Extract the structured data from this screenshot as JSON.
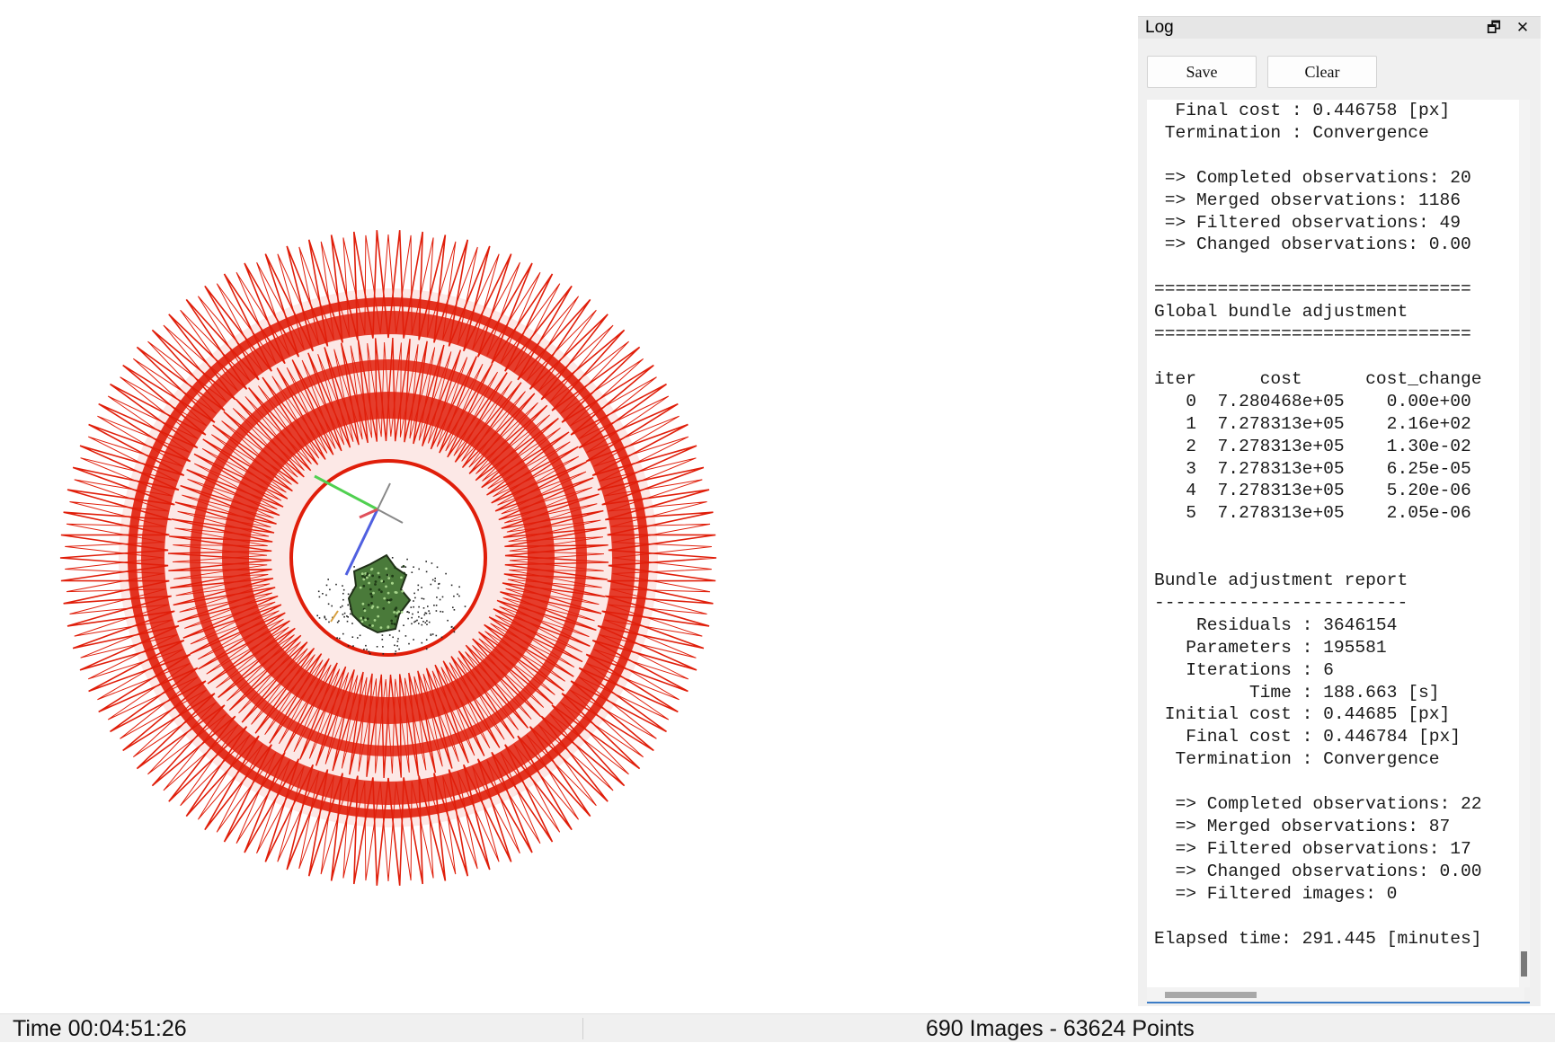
{
  "log_panel": {
    "title": "Log",
    "float_icon": "restore-window-icon",
    "close_icon": "close-icon",
    "save_label": "Save",
    "clear_label": "Clear",
    "lines": [
      "  Final cost : 0.446758 [px]",
      " Termination : Convergence",
      "",
      " => Completed observations: 20",
      " => Merged observations: 1186",
      " => Filtered observations: 49",
      " => Changed observations: 0.00",
      "",
      "==============================",
      "Global bundle adjustment",
      "==============================",
      "",
      "iter      cost      cost_change",
      "   0  7.280468e+05    0.00e+00",
      "   1  7.278313e+05    2.16e+02",
      "   2  7.278313e+05    1.30e-02",
      "   3  7.278313e+05    6.25e-05",
      "   4  7.278313e+05    5.20e-06",
      "   5  7.278313e+05    2.05e-06",
      "",
      "",
      "Bundle adjustment report",
      "------------------------",
      "    Residuals : 3646154",
      "   Parameters : 195581",
      "   Iterations : 6",
      "         Time : 188.663 [s]",
      " Initial cost : 0.44685 [px]",
      "   Final cost : 0.446784 [px]",
      "  Termination : Convergence",
      "",
      "  => Completed observations: 22",
      "  => Merged observations: 87",
      "  => Filtered observations: 17",
      "  => Changed observations: 0.00",
      "  => Filtered images: 0",
      "",
      "Elapsed time: 291.445 [minutes]"
    ]
  },
  "status_bar": {
    "time_text": "Time 00:04:51:26",
    "counts_text": "690 Images - 63624 Points"
  },
  "viewport": {
    "camera_frustum_color": "#e01e0a",
    "axis_colors": {
      "x": "#e0505a",
      "y": "#50d050",
      "z": "#5060e0"
    },
    "point_cloud_color": "#4a7a3a"
  }
}
